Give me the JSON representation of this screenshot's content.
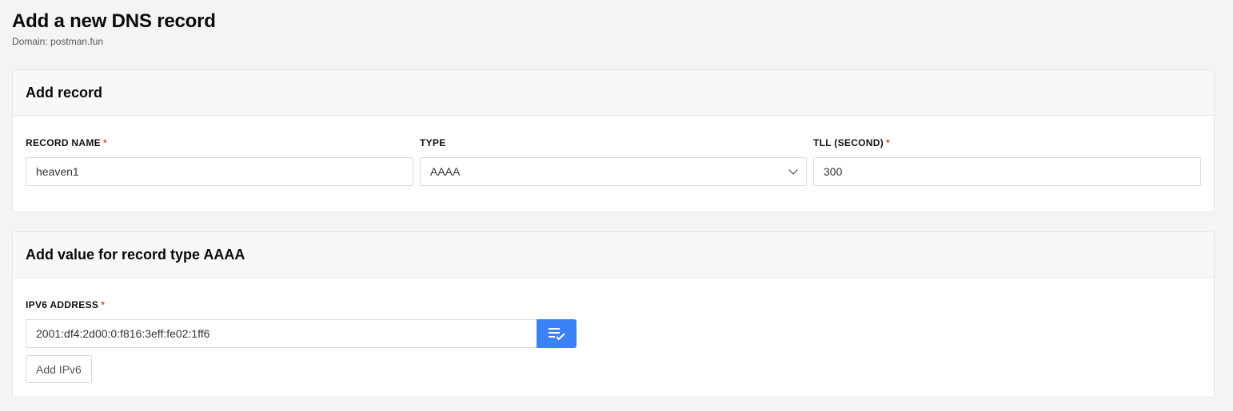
{
  "header": {
    "title": "Add a new DNS record",
    "subtitle": "Domain: postman.fun"
  },
  "record_card": {
    "title": "Add record",
    "fields": {
      "record_name": {
        "label": "RECORD NAME",
        "required_mark": "*",
        "value": "heaven1"
      },
      "type": {
        "label": "TYPE",
        "value": "AAAA",
        "icon": "chevron-down-icon"
      },
      "ttl": {
        "label": "TLL (SECOND)",
        "required_mark": "*",
        "value": "300"
      }
    }
  },
  "value_card": {
    "title": "Add value for record type AAAA",
    "ipv6": {
      "label": "IPV6 ADDRESS",
      "required_mark": "*",
      "value": "2001:df4:2d00:0:f816:3eff:fe02:1ff6",
      "action_icon": "playlist-check-icon",
      "action_color": "#3b82f6"
    },
    "add_button_label": "Add IPv6"
  },
  "colors": {
    "accent": "#3b82f6",
    "required": "#e0483c",
    "background": "#f4f4f4"
  }
}
